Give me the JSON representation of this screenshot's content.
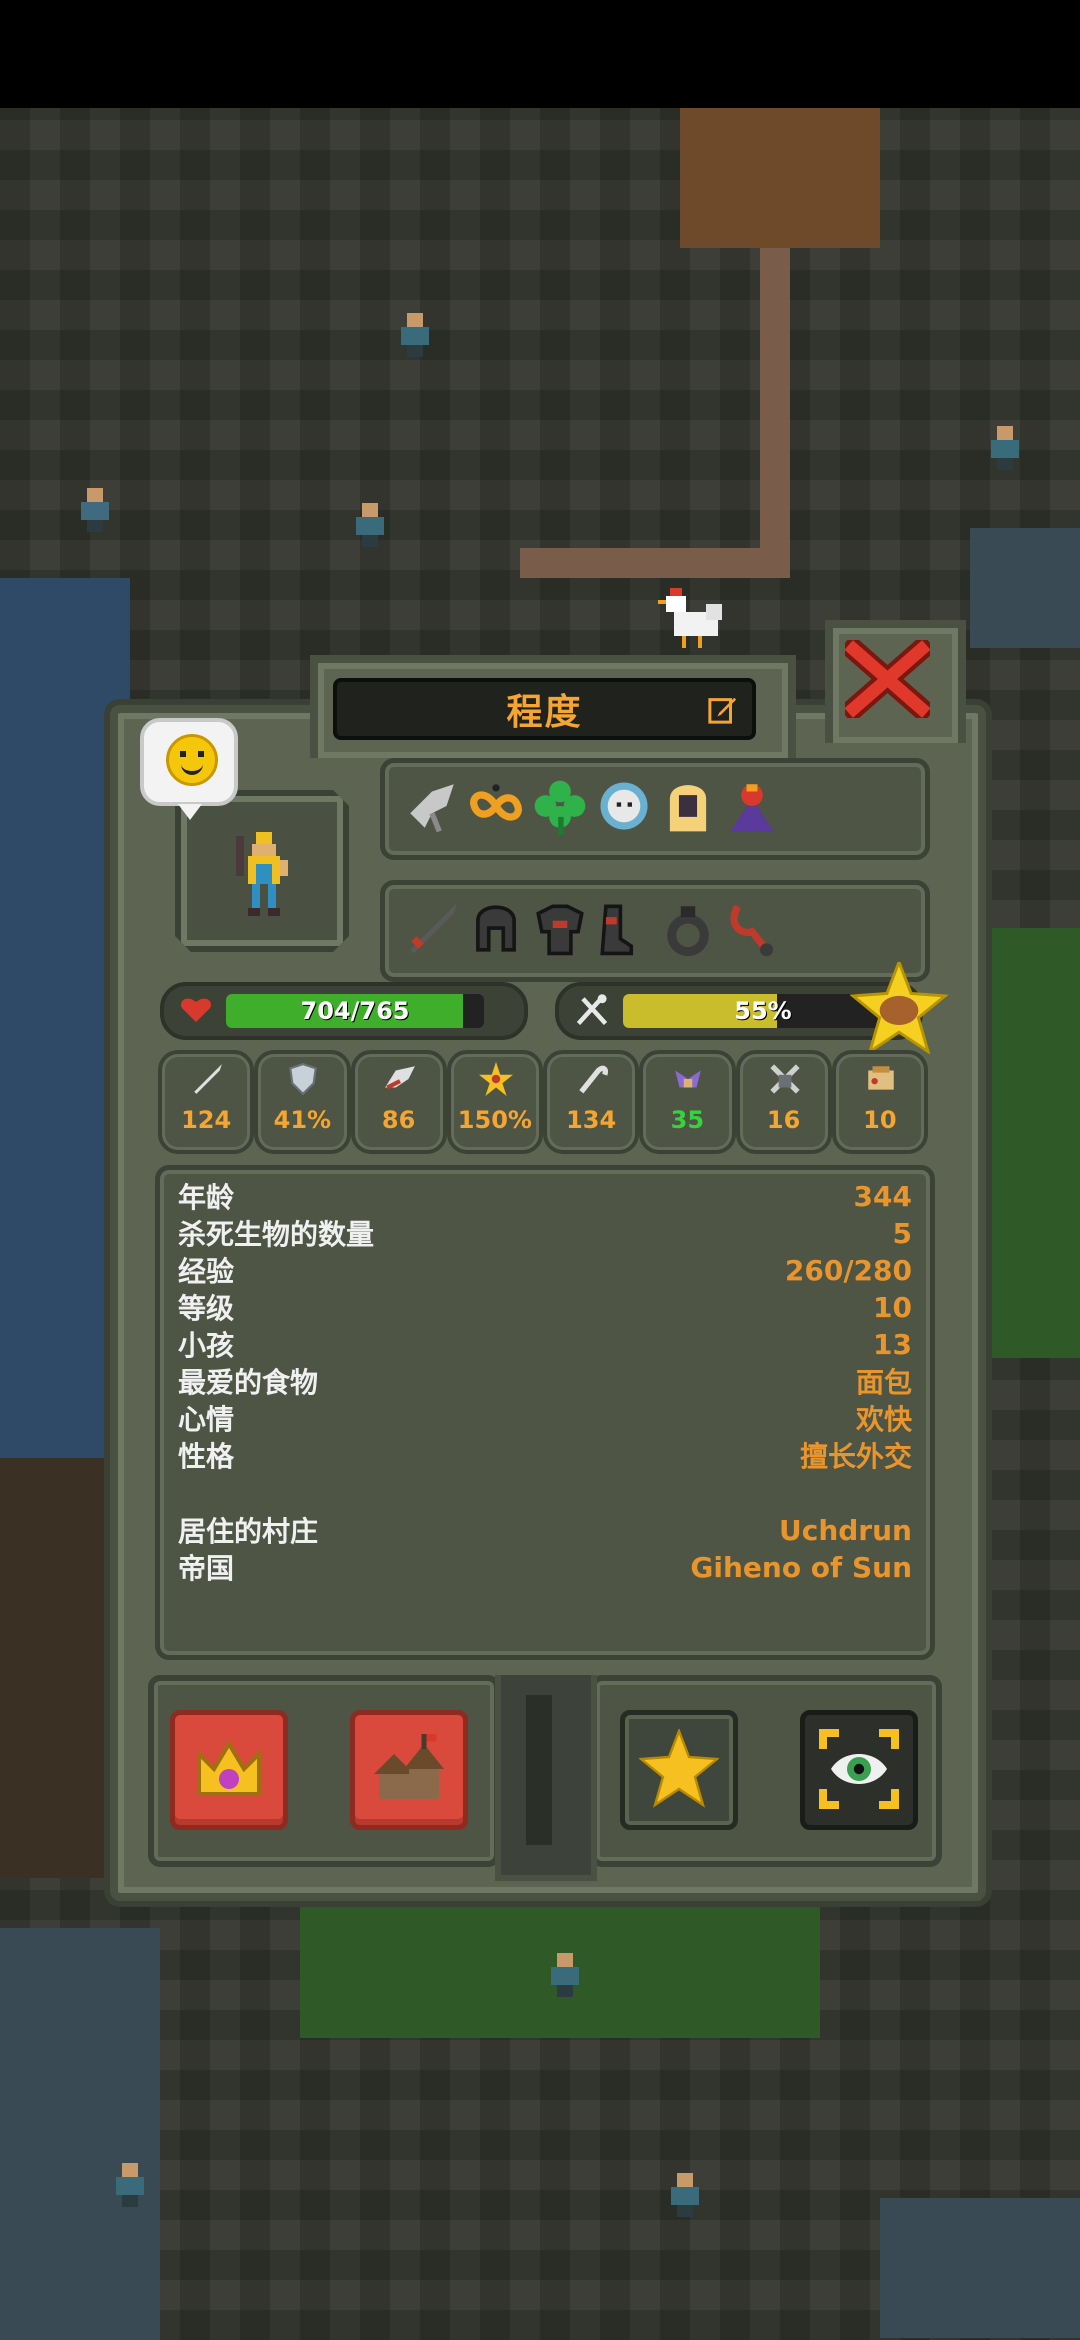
{
  "unit": {
    "name": "程度",
    "mood_icon": "smiley-face-icon",
    "portrait_icon": "villager-portrait-icon"
  },
  "traits": [
    "wings-icon",
    "infinity-icon",
    "clover-icon",
    "ghost-face-icon",
    "blonde-hair-icon",
    "dark-wizard-icon"
  ],
  "equipment": [
    "sword-icon",
    "helmet-icon",
    "chest-armor-icon",
    "boots-icon",
    "ring-icon",
    "amulet-icon"
  ],
  "health": {
    "label": "704/765",
    "fraction": 0.92
  },
  "hunger": {
    "label": "55%",
    "fraction": 0.55,
    "favorite_food_icon": "bread-star-icon"
  },
  "stats": [
    {
      "icon": "damage-icon",
      "value": "124"
    },
    {
      "icon": "armor-icon",
      "value": "41%"
    },
    {
      "icon": "speed-icon",
      "value": "86"
    },
    {
      "icon": "critical-icon",
      "value": "150%"
    },
    {
      "icon": "attack-speed-icon",
      "value": "134"
    },
    {
      "icon": "diplomacy-icon",
      "value": "35",
      "highlight": true
    },
    {
      "icon": "warfare-icon",
      "value": "16"
    },
    {
      "icon": "stewardship-icon",
      "value": "10"
    }
  ],
  "info": [
    {
      "key": "年龄",
      "value": "344"
    },
    {
      "key": "杀死生物的数量",
      "value": "5"
    },
    {
      "key": "经验",
      "value": "260/280"
    },
    {
      "key": "等级",
      "value": "10"
    },
    {
      "key": "小孩",
      "value": "13"
    },
    {
      "key": "最爱的食物",
      "value": "面包"
    },
    {
      "key": "心情",
      "value": "欢快"
    },
    {
      "key": "性格",
      "value": "擅长外交"
    },
    {
      "key": "居住的村庄",
      "value": "Uchdrun"
    },
    {
      "key": "帝国",
      "value": "Giheno of Sun"
    }
  ],
  "actions": {
    "kingdom": "crown-icon",
    "village": "village-icon",
    "favorite": "star-icon",
    "follow": "eye-icon"
  },
  "colors": {
    "accent_text": "#f5a531",
    "health": "#3fae2a",
    "hunger": "#c9bd2c",
    "close": "#d9382c"
  }
}
